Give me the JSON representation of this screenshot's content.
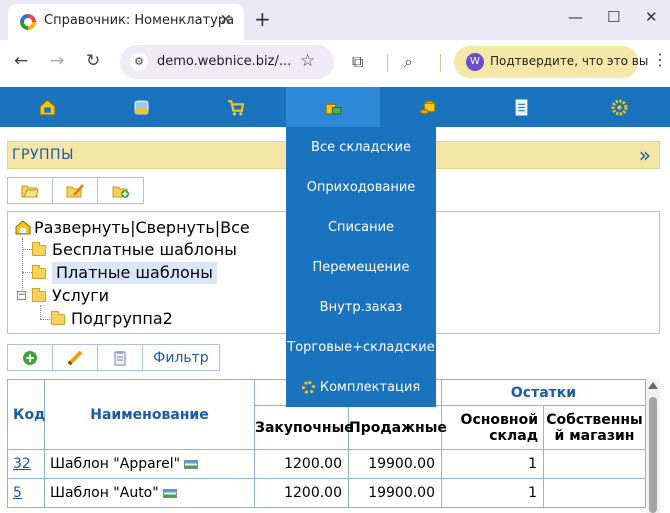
{
  "browser": {
    "tab_title": "Справочник: Номенклатура",
    "url": "demo.webnice.biz/...",
    "profile_initial": "W",
    "profile_text": "Подтвердите, что это вы"
  },
  "nav": {
    "icons": [
      "home-icon",
      "database-icon",
      "cart-icon",
      "warehouse-icon",
      "coins-icon",
      "document-icon",
      "settings-icon"
    ],
    "active_index": 3
  },
  "dropdown": {
    "items": [
      "Все складские",
      "Оприходование",
      "Списание",
      "Перемещение",
      "Внутр.заказ",
      "Торговые+складские",
      "Комплектация"
    ]
  },
  "groups": {
    "title": "ГРУППЫ",
    "toolbar_icons": [
      "open-folder-icon",
      "edit-folder-icon",
      "add-folder-icon"
    ]
  },
  "tree": {
    "root_label": "Развернуть|Свернуть|Все",
    "items": [
      {
        "label": "Бесплатные шаблоны"
      },
      {
        "label": "Платные шаблоны",
        "selected": true
      },
      {
        "label": "Услуги"
      },
      {
        "label": "Подгруппа2"
      }
    ]
  },
  "item_toolbar": {
    "icons": [
      "add-icon",
      "edit-icon",
      "copy-icon"
    ],
    "filter_label": "Фильтр"
  },
  "table": {
    "headers": {
      "code": "Код",
      "name": "Наименование",
      "stock_group": "Остатки",
      "purchase": "Закупочные",
      "sale": "Продажные",
      "main_warehouse": "Основной склад",
      "own_shop": "Собственный магазин"
    },
    "rows": [
      {
        "code": "32",
        "name": "Шаблон \"Apparel\"",
        "purchase": "1200.00",
        "sale": "19900.00",
        "stock": "1",
        "own": ""
      },
      {
        "code": "5",
        "name": "Шаблон \"Auto\"",
        "purchase": "1200.00",
        "sale": "19900.00",
        "stock": "1",
        "own": ""
      }
    ]
  }
}
